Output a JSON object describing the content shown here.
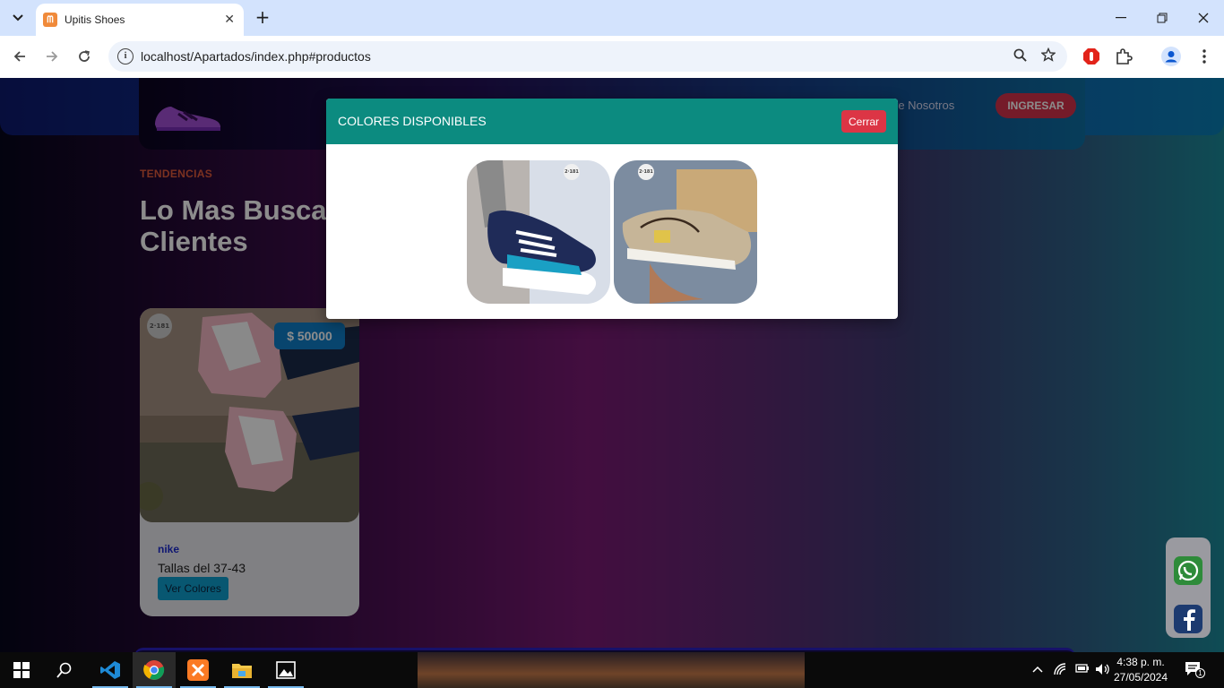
{
  "browser": {
    "tab_title": "Upitis Shoes",
    "url": "localhost/Apartados/index.php#productos",
    "favicon_icon": "xampp-icon"
  },
  "site": {
    "nav_link_partial": "re Nosotros",
    "login_label": "INGRESAR",
    "kicker": "TENDENCIAS",
    "headline_line1": "Lo Mas Buscac",
    "headline_line2": "Clientes"
  },
  "product": {
    "badge": "2·181",
    "price": "$ 50000",
    "brand": "nike",
    "sizes": "Tallas del 37-43",
    "colors_button": "Ver Colores"
  },
  "modal": {
    "title": "COLORES DISPONIBLES",
    "close_label": "Cerrar",
    "options": [
      {
        "badge": "2·181",
        "color": "navy-white-teal"
      },
      {
        "badge": "2·181",
        "color": "khaki-beige"
      }
    ]
  },
  "taskbar": {
    "time": "4:38 p. m.",
    "date": "27/05/2024",
    "notification_count": "1"
  },
  "colors": {
    "accent_teal": "#0c8b80",
    "danger": "#dc3545",
    "price_blue": "#0f7ec8",
    "kicker_orange": "#e05a3b"
  }
}
